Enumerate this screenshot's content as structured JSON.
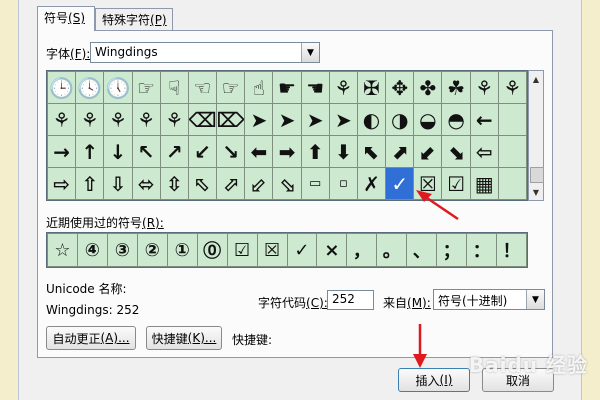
{
  "tabs": [
    {
      "label": "符号",
      "access_key": "(S)"
    },
    {
      "label": "特殊字符",
      "access_key": "(P)"
    }
  ],
  "font": {
    "label": "字体",
    "access_key": "(F):",
    "value": "Wingdings"
  },
  "symbol_grid": {
    "rows": [
      [
        "🕒",
        "🕓",
        "🕔",
        "☞",
        "☟",
        "☜",
        "☞",
        "☝",
        "☛",
        "☚",
        "⚘",
        "✠",
        "✥",
        "✤",
        "☘",
        "⚘",
        "⚘"
      ],
      [
        "⚘",
        "⚘",
        "⚘",
        "⚘",
        "⚘",
        "⌫",
        "⌦",
        "➤",
        "➤",
        "➤",
        "➤",
        "◐",
        "◑",
        "◒",
        "◓",
        "←",
        " "
      ],
      [
        "→",
        "↑",
        "↓",
        "↖",
        "↗",
        "↙",
        "↘",
        "⬅",
        "➡",
        "⬆",
        "⬇",
        "⬉",
        "⬈",
        "⬋",
        "⬊",
        "⇦",
        " "
      ],
      [
        "⇨",
        "⇧",
        "⇩",
        "⬄",
        "⇳",
        "⬁",
        "⬀",
        "⬃",
        "⬂",
        "▭",
        "▫",
        "✗",
        "✓",
        "☒",
        "☑",
        "▦",
        " "
      ]
    ],
    "selected": "✓",
    "colors": {
      "cell_bg": "#cde9cf",
      "selected_bg": "#2f6fd6",
      "grid_line": "#7f8f7f"
    }
  },
  "recent": {
    "label": "近期使用过的符号",
    "access_key": "(R):",
    "items": [
      "☆",
      "④",
      "③",
      "②",
      "①",
      "⓪",
      "☑",
      "☒",
      "✓",
      "×",
      "，",
      "。",
      "、",
      "；",
      "：",
      "！"
    ]
  },
  "info": {
    "unicode_name_label": "Unicode 名称:",
    "char_name": "Wingdings: 252",
    "char_code_label": "字符代码",
    "char_code_access": "(C):",
    "char_code_value": "252",
    "from_label": "来自",
    "from_access": "(M):",
    "from_value": "符号(十进制)"
  },
  "buttons": {
    "autocorrect": "自动更正",
    "autocorrect_access": "(A)...",
    "shortcut": "快捷键",
    "shortcut_access": "(K)...",
    "shortcut_label": "快捷键:",
    "insert": "插入",
    "insert_access": "(I)",
    "cancel": "取消"
  },
  "watermark": "Baidu 经验"
}
